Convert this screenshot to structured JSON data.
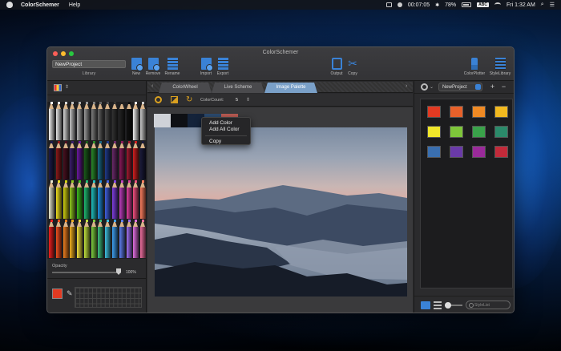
{
  "menubar": {
    "app_name": "ColorSchemer",
    "menu_help": "Help",
    "timer": "00:07:05",
    "battery": "78%",
    "input_source": "ABC",
    "clock": "Fri 1:32 AM"
  },
  "window": {
    "title": "ColorSchemer",
    "project_name": "NewProject",
    "library_label": "Library"
  },
  "toolbar": {
    "new": "New",
    "remove": "Remove",
    "rename": "Rename",
    "import": "Import",
    "export": "Export",
    "output": "Output",
    "copy": "Copy",
    "colorplotter": "ColorPlotter",
    "stylelibrary": "StyleLibrary"
  },
  "tabs": [
    "ColorWheel",
    "Live Scheme",
    "Image Palette"
  ],
  "active_tab": "Image Palette",
  "options": {
    "color_count_label": "ColorCount:",
    "color_count_value": "5"
  },
  "palette_strip": [
    "#cfd2d8",
    "#0e1014",
    "#14233a",
    "#2b4a6e",
    "#b85a52"
  ],
  "context_menu": [
    "Add Color",
    "Add All Color",
    "Copy"
  ],
  "sidebar": {
    "opacity_label": "Opacity",
    "opacity_value": "100%",
    "opacity_level": 1.0,
    "current_color": "#e23a22",
    "pencil_rows": [
      [
        "#f5f5f5",
        "#e8e8e8",
        "#d8d8d8",
        "#c4c4c4",
        "#b0b0b0",
        "#9a9a9a",
        "#808080",
        "#666",
        "#4d4d4d",
        "#333",
        "#222",
        "#111",
        "#eee",
        "#ccc"
      ],
      [
        "#1b1b4a",
        "#8b1a1a",
        "#4a1020",
        "#3a1e6a",
        "#6a1aa0",
        "#1a5a1a",
        "#2a8a2a",
        "#1a6a8a",
        "#203a8a",
        "#6a2a6a",
        "#8a1a5a",
        "#a01a30",
        "#d02020",
        "#1a1a3a"
      ],
      [
        "#e8e8d0",
        "#f0e020",
        "#d0d010",
        "#90c820",
        "#3cb820",
        "#20b870",
        "#20c0c0",
        "#2090e0",
        "#4060e0",
        "#8040e0",
        "#c040c0",
        "#e040a0",
        "#f05080",
        "#ff8060"
      ],
      [
        "#f02020",
        "#f05020",
        "#f08020",
        "#f0b020",
        "#f0e040",
        "#c0e040",
        "#80d040",
        "#40c080",
        "#40c0e0",
        "#40a0f0",
        "#6080f0",
        "#a070f0",
        "#e070e0",
        "#f070a0"
      ]
    ]
  },
  "right_panel": {
    "project_select": "NewProject",
    "search_placeholder": "StyleList",
    "swatches": [
      "#e23a22",
      "#e8612a",
      "#f08a24",
      "#f2b91f",
      "#f0e62a",
      "#7ec63a",
      "#3aa24a",
      "#2b8a6a",
      "#3a6fb0",
      "#6a3aa8",
      "#9a2a9a",
      "#c22a3a"
    ]
  },
  "icons": {
    "menubar": [
      "apple-icon",
      "screen-icon",
      "record-icon",
      "battery-icon",
      "wifi-icon",
      "search-icon",
      "menu-icon"
    ],
    "toolbar": [
      "new-doc-icon",
      "remove-doc-icon",
      "rename-doc-icon",
      "import-icon",
      "export-icon",
      "output-icon",
      "copy-cut-icon",
      "brush-icon",
      "list-icon"
    ]
  }
}
